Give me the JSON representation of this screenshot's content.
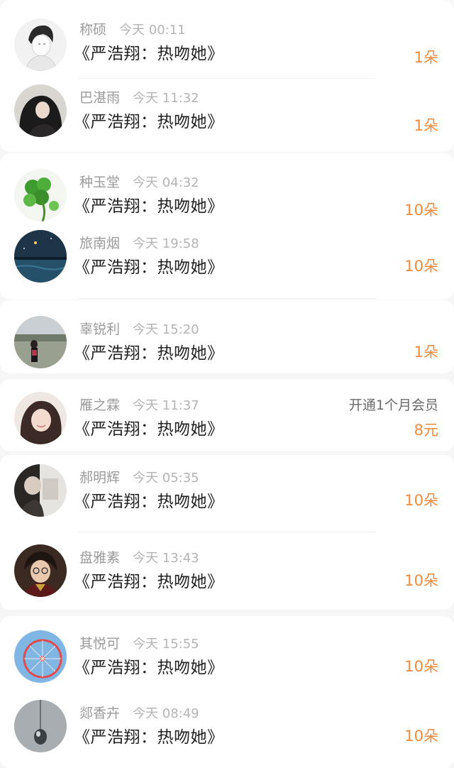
{
  "gifts": [
    {
      "name": "称硕",
      "time_label": "今天 00:11",
      "book_title": "《严浩翔：热吻她》",
      "amount": "1朵",
      "note": "",
      "avatar_icon": "boy-sketch-avatar-icon"
    },
    {
      "name": "巴湛雨",
      "time_label": "今天 11:32",
      "book_title": "《严浩翔：热吻她》",
      "amount": "1朵",
      "note": "",
      "avatar_icon": "dark-hair-girl-avatar-icon"
    },
    {
      "name": "种玉堂",
      "time_label": "今天 04:32",
      "book_title": "《严浩翔：热吻她》",
      "amount": "10朵",
      "note": "",
      "avatar_icon": "clover-avatar-icon"
    },
    {
      "name": "旅南烟",
      "time_label": "今天 19:58",
      "book_title": "《严浩翔：热吻她》",
      "amount": "10朵",
      "note": "",
      "avatar_icon": "night-lake-avatar-icon"
    },
    {
      "name": "辜锐利",
      "time_label": "今天 15:20",
      "book_title": "《严浩翔：热吻她》",
      "amount": "1朵",
      "note": "",
      "avatar_icon": "girl-in-field-avatar-icon"
    },
    {
      "name": "雁之霖",
      "time_label": "今天 11:37",
      "book_title": "《严浩翔：热吻她》",
      "amount": "8元",
      "note": "开通1个月会员",
      "avatar_icon": "smiling-girl-avatar-icon"
    },
    {
      "name": "郝明辉",
      "time_label": "今天 05:35",
      "book_title": "《严浩翔：热吻她》",
      "amount": "10朵",
      "note": "",
      "avatar_icon": "sketch-figures-avatar-icon"
    },
    {
      "name": "盘雅素",
      "time_label": "今天 13:43",
      "book_title": "《严浩翔：热吻她》",
      "amount": "10朵",
      "note": "",
      "avatar_icon": "boy-with-glasses-avatar-icon"
    },
    {
      "name": "其悦可",
      "time_label": "今天 15:55",
      "book_title": "《严浩翔：热吻她》",
      "amount": "10朵",
      "note": "",
      "avatar_icon": "ferris-wheel-avatar-icon"
    },
    {
      "name": "郯香卉",
      "time_label": "今天 08:49",
      "book_title": "《严浩翔：热吻她》",
      "amount": "10朵",
      "note": "",
      "avatar_icon": "water-drop-avatar-icon"
    }
  ],
  "colors": {
    "amount": "#f08a3c",
    "name": "#9a9a9a",
    "title": "#222222",
    "background": "#f6f6f6",
    "card": "#ffffff"
  }
}
